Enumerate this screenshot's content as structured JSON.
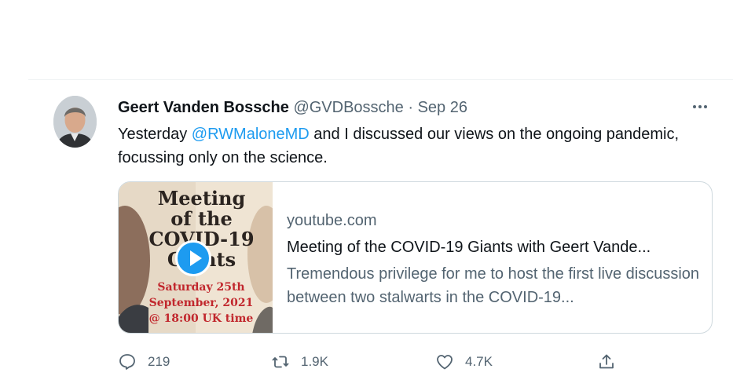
{
  "tweet": {
    "author_name": "Geert Vanden Bossche",
    "author_handle": "@GVDBossche",
    "separator": "·",
    "date": "Sep 26",
    "text_before": "Yesterday ",
    "mention": "@RWMaloneMD",
    "text_after": " and I discussed our views on the ongoing pandemic, focussing only on the science."
  },
  "card": {
    "thumbnail_lines": [
      "Meeting",
      "of the",
      "COVID-19",
      "Giants"
    ],
    "thumbnail_sub": [
      "Saturday 25th",
      "September, 2021",
      "@ 18:00 UK time"
    ],
    "domain": "youtube.com",
    "title": "Meeting of the COVID-19 Giants with Geert Vande...",
    "description": "Tremendous privilege for me to host the first live discussion between two stalwarts in the COVID-19..."
  },
  "actions": {
    "replies": "219",
    "retweets": "1.9K",
    "likes": "4.7K"
  },
  "icons": {
    "reply": "reply-icon",
    "retweet": "retweet-icon",
    "like": "like-icon",
    "share": "share-icon",
    "more": "more-icon",
    "play": "play-icon"
  },
  "colors": {
    "accent": "#1d9bf0",
    "text": "#0f1419",
    "muted": "#536471"
  }
}
